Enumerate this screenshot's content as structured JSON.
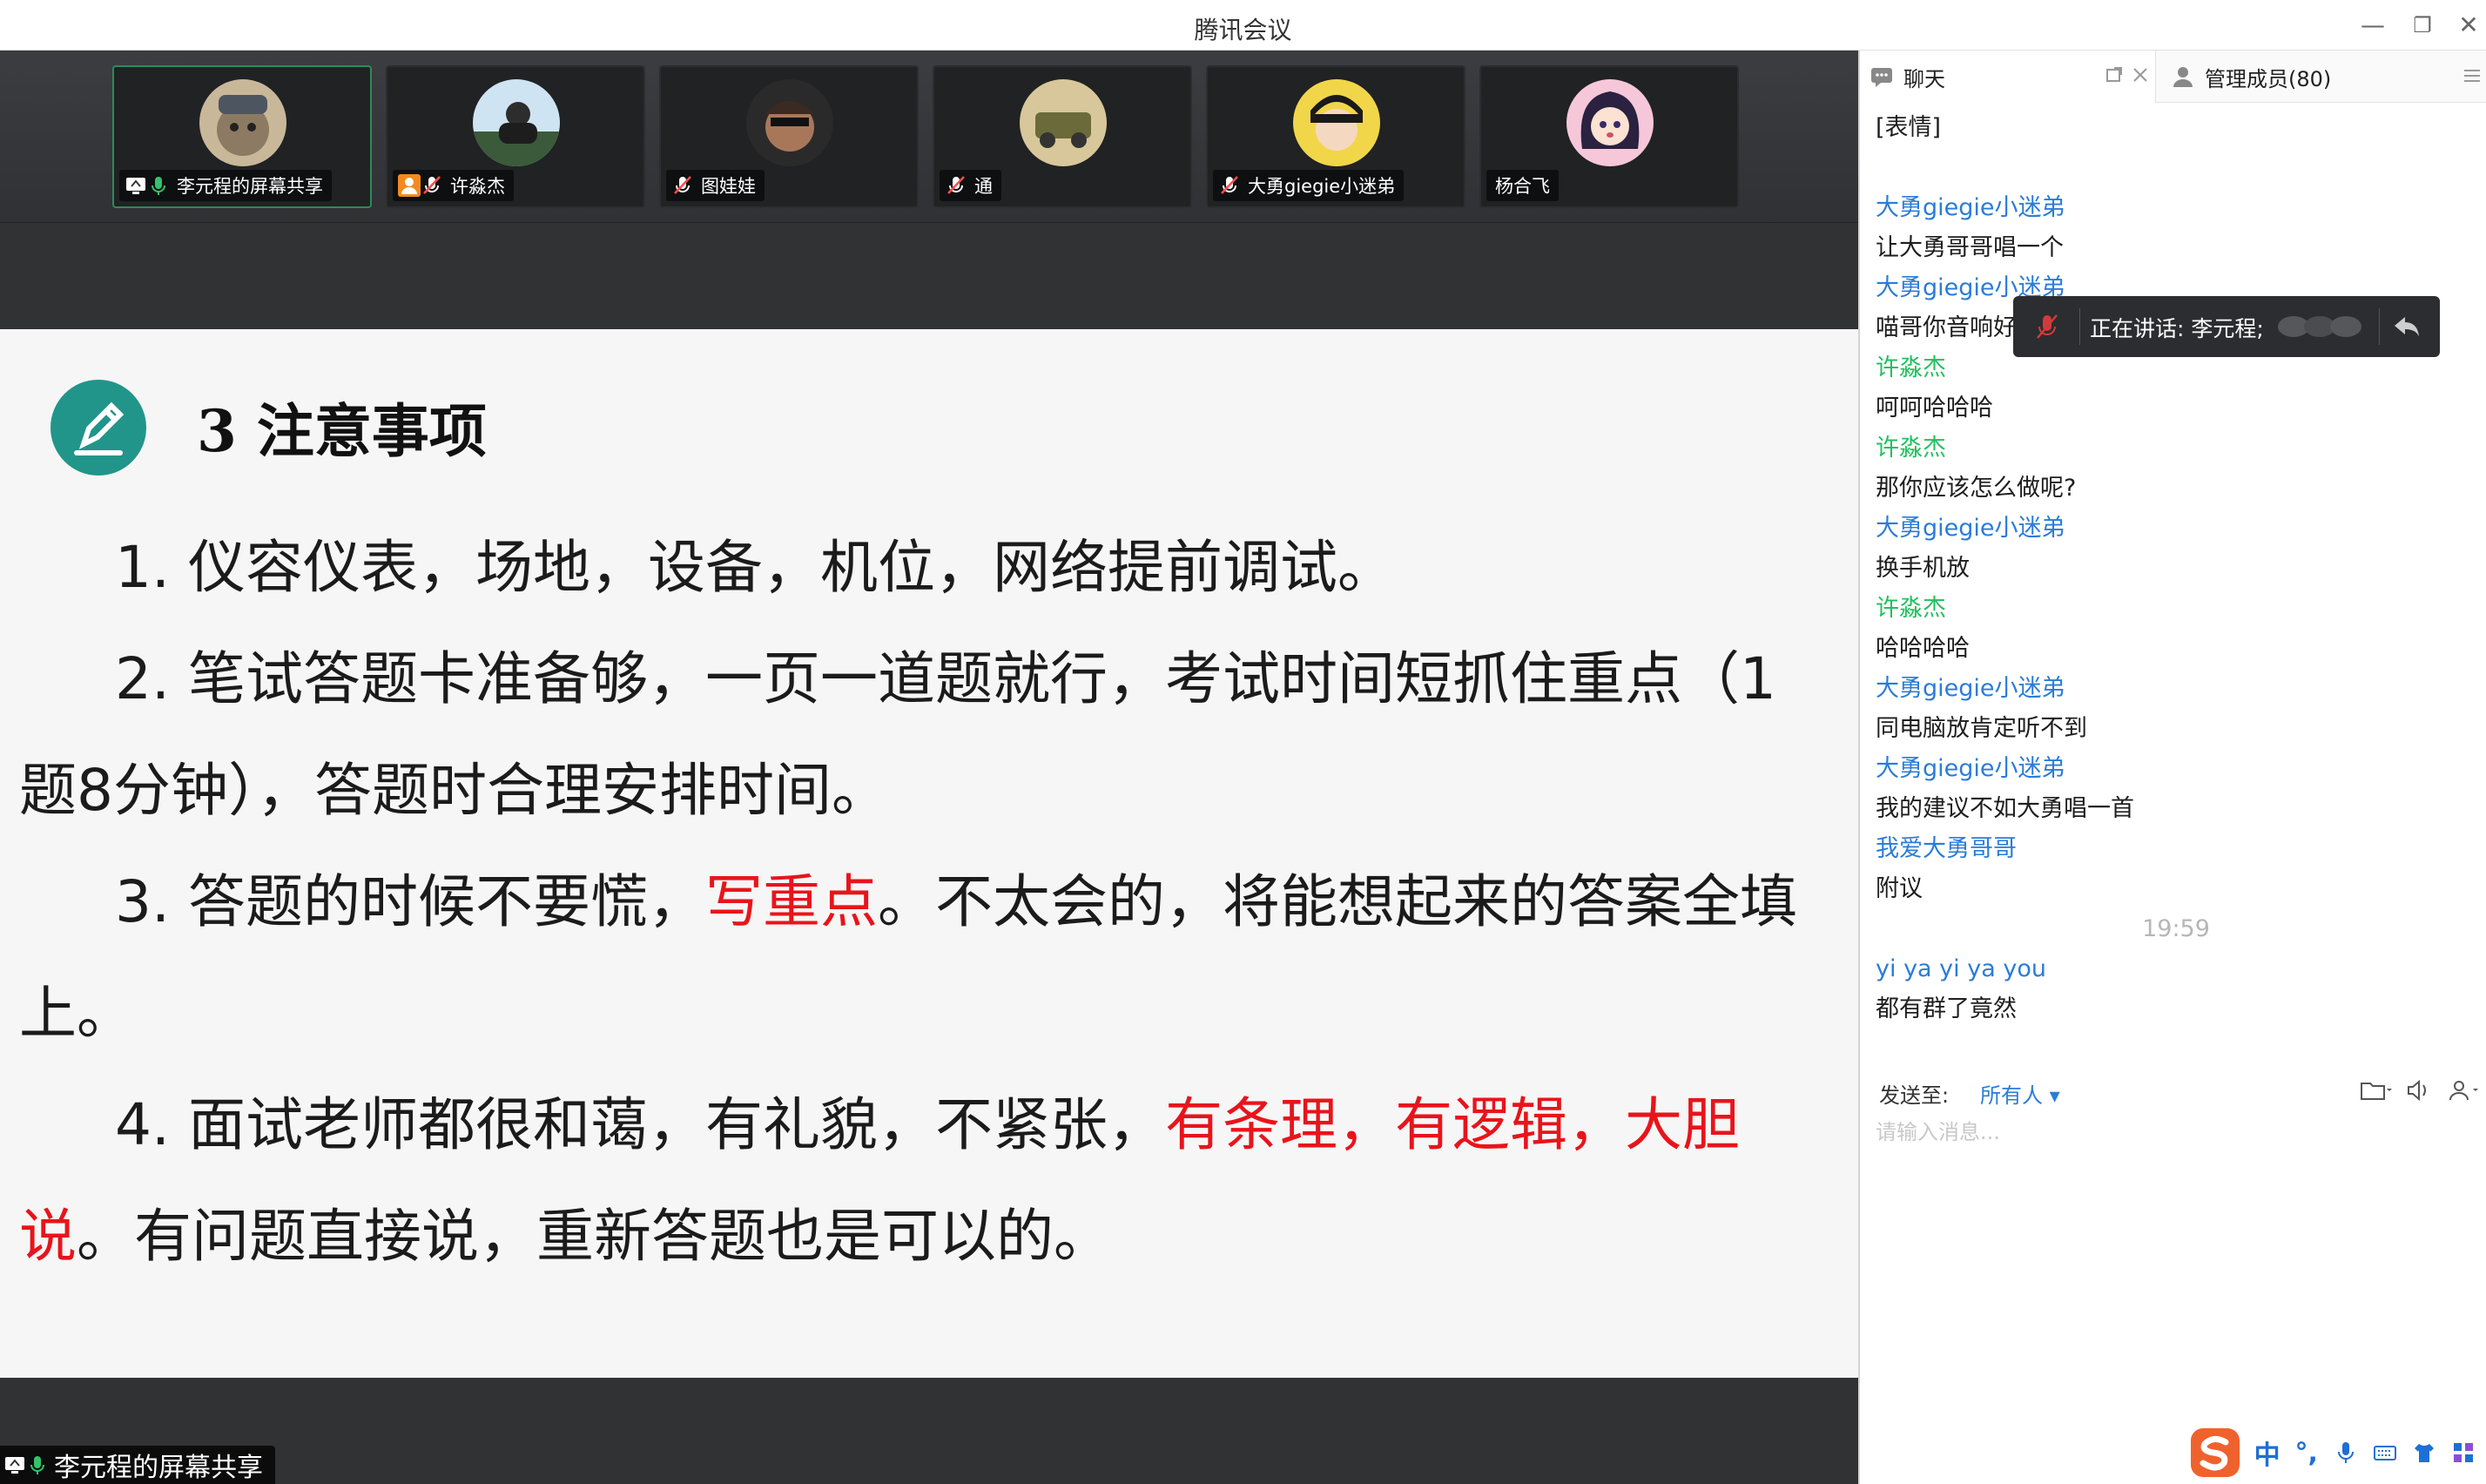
{
  "window": {
    "title": "腾讯会议",
    "minimize_glyph": "—",
    "restore_glyph": "❐",
    "close_glyph": "✕"
  },
  "participants": [
    {
      "name": "李元程的屏幕共享",
      "icons": [
        "screen-share-icon",
        "mic-on-icon"
      ],
      "active": true
    },
    {
      "name": "许淼杰",
      "icons": [
        "person-icon",
        "mic-muted-icon"
      ]
    },
    {
      "name": "图娃娃",
      "icons": [
        "mic-muted-icon"
      ]
    },
    {
      "name": "通",
      "icons": [
        "mic-muted-icon"
      ]
    },
    {
      "name": "大勇giegie小迷弟",
      "icons": [
        "mic-muted-icon"
      ]
    },
    {
      "name": "杨合飞",
      "icons": []
    }
  ],
  "slide": {
    "heading": "3 注意事项",
    "item1": "1. 仪容仪表，场地，设备，机位，网络提前调试。",
    "item2": "2. 笔试答题卡准备够，一页一道题就行，考试时间短抓住重点（1题8分钟），答题时合理安排时间。",
    "item3_a": "3. 答题的时候不要慌，",
    "item3_red": "写重点",
    "item3_b": "。不太会的，将能想起来的答案全填上。",
    "item4_a": "4. 面试老师都很和蔼，有礼貌，不紧张，",
    "item4_red": "有条理，有逻辑，大胆说",
    "item4_b": "。有问题直接说，重新答题也是可以的。"
  },
  "share_indicator": {
    "label": "李元程的屏幕共享"
  },
  "panel": {
    "tab_chat": "聊天",
    "tab_members": "管理成员(80)",
    "messages": [
      {
        "kind": "text",
        "text": "[表情]"
      },
      {
        "kind": "blank",
        "text": ""
      },
      {
        "kind": "sender-blue",
        "text": "大勇giegie小迷弟"
      },
      {
        "kind": "text",
        "text": "让大勇哥哥唱一个"
      },
      {
        "kind": "sender-blue",
        "text": "大勇giegie小迷弟"
      },
      {
        "kind": "text",
        "text": "喵哥你音响好"
      },
      {
        "kind": "sender-green",
        "text": "许淼杰"
      },
      {
        "kind": "text",
        "text": "呵呵哈哈哈"
      },
      {
        "kind": "sender-green",
        "text": "许淼杰"
      },
      {
        "kind": "text",
        "text": "那你应该怎么做呢?"
      },
      {
        "kind": "sender-blue",
        "text": "大勇giegie小迷弟"
      },
      {
        "kind": "text",
        "text": "换手机放"
      },
      {
        "kind": "sender-green",
        "text": "许淼杰"
      },
      {
        "kind": "text",
        "text": "哈哈哈哈"
      },
      {
        "kind": "sender-blue",
        "text": "大勇giegie小迷弟"
      },
      {
        "kind": "text",
        "text": "同电脑放肯定听不到"
      },
      {
        "kind": "sender-blue",
        "text": "大勇giegie小迷弟"
      },
      {
        "kind": "text",
        "text": "我的建议不如大勇唱一首"
      },
      {
        "kind": "sender-blue",
        "text": "我爱大勇哥哥"
      },
      {
        "kind": "text",
        "text": "附议"
      },
      {
        "kind": "timestamp",
        "text": "19:59"
      },
      {
        "kind": "sender-blue",
        "text": "yi ya yi ya you"
      },
      {
        "kind": "text",
        "text": "都有群了竟然"
      }
    ],
    "speaking_toast": "正在讲话: 李元程;",
    "send_label": "发送至:",
    "send_target": "所有人 ▾",
    "input_placeholder": "请输入消息..."
  },
  "ime": {
    "lang": "中",
    "punct": "°,"
  },
  "colors": {
    "sender_blue": "#2a7cd8",
    "sender_green": "#22c05f",
    "slide_red": "#e8141b",
    "icon_teal": "#21958a",
    "active_tile_border": "#2e8b57"
  }
}
